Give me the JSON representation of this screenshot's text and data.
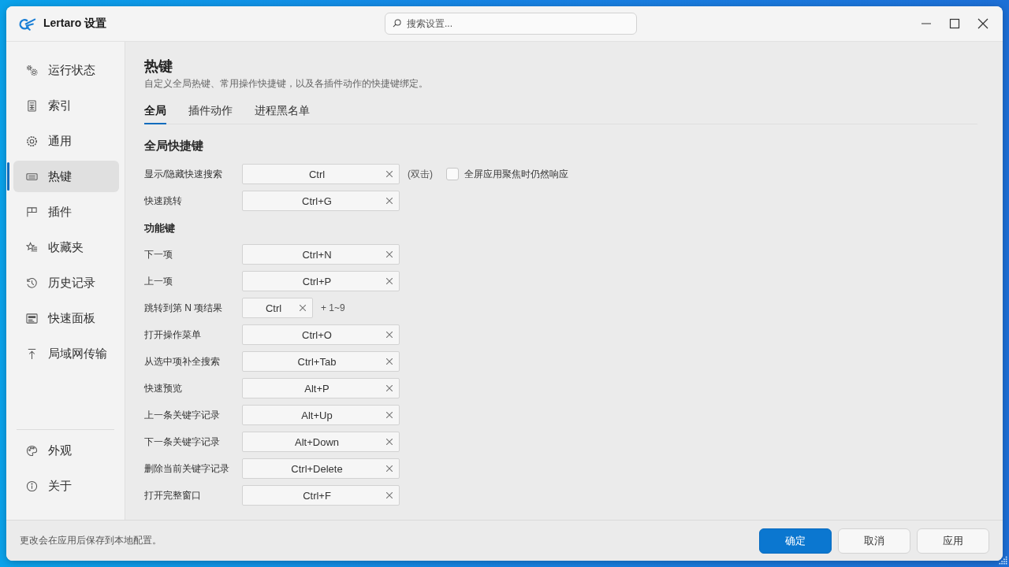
{
  "window": {
    "title": "Lertaro 设置"
  },
  "search": {
    "placeholder": "搜索设置..."
  },
  "sidebar": {
    "items": [
      {
        "label": "运行状态",
        "selected": false
      },
      {
        "label": "索引",
        "selected": false
      },
      {
        "label": "通用",
        "selected": false
      },
      {
        "label": "热键",
        "selected": true
      },
      {
        "label": "插件",
        "selected": false
      },
      {
        "label": "收藏夹",
        "selected": false
      },
      {
        "label": "历史记录",
        "selected": false
      },
      {
        "label": "快速面板",
        "selected": false
      },
      {
        "label": "局域网传输",
        "selected": false
      }
    ],
    "bottom_items": [
      {
        "label": "外观",
        "selected": false
      },
      {
        "label": "关于",
        "selected": false
      }
    ]
  },
  "page": {
    "title": "热键",
    "description": "自定义全局热键、常用操作快捷键，以及各插件动作的快捷键绑定。",
    "tabs": [
      {
        "label": "全局",
        "selected": true
      },
      {
        "label": "插件动作",
        "selected": false
      },
      {
        "label": "进程黑名单",
        "selected": false
      }
    ],
    "sections": [
      {
        "title": "全局快捷键",
        "kind": "main",
        "rows": [
          {
            "label": "显示/隐藏快速搜索",
            "kind": "wide",
            "value": "Ctrl",
            "suffix": "(双击)",
            "option": {
              "label": "全屏应用聚焦时仍然响应",
              "checked": false
            }
          },
          {
            "label": "快速跳转",
            "kind": "wide",
            "value": "Ctrl+G"
          }
        ]
      },
      {
        "title": "功能键",
        "kind": "sub",
        "rows": [
          {
            "label": "下一项",
            "kind": "wide",
            "value": "Ctrl+N"
          },
          {
            "label": "上一项",
            "kind": "wide",
            "value": "Ctrl+P"
          },
          {
            "label": "跳转到第 N 项结果",
            "kind": "short",
            "value": "Ctrl",
            "suffix": "+ 1~9"
          },
          {
            "label": "打开操作菜单",
            "kind": "wide",
            "value": "Ctrl+O"
          },
          {
            "label": "从选中项补全搜索",
            "kind": "wide",
            "value": "Ctrl+Tab"
          },
          {
            "label": "快速预览",
            "kind": "wide",
            "value": "Alt+P"
          },
          {
            "label": "上一条关键字记录",
            "kind": "wide",
            "value": "Alt+Up"
          },
          {
            "label": "下一条关键字记录",
            "kind": "wide",
            "value": "Alt+Down"
          },
          {
            "label": "删除当前关键字记录",
            "kind": "wide",
            "value": "Ctrl+Delete"
          },
          {
            "label": "打开完整窗口",
            "kind": "wide",
            "value": "Ctrl+F"
          }
        ]
      }
    ]
  },
  "footer": {
    "note": "更改会在应用后保存到本地配置。",
    "buttons": [
      {
        "label": "确定",
        "kind": "primary"
      },
      {
        "label": "取消",
        "kind": "secondary"
      },
      {
        "label": "应用",
        "kind": "secondary"
      }
    ]
  }
}
